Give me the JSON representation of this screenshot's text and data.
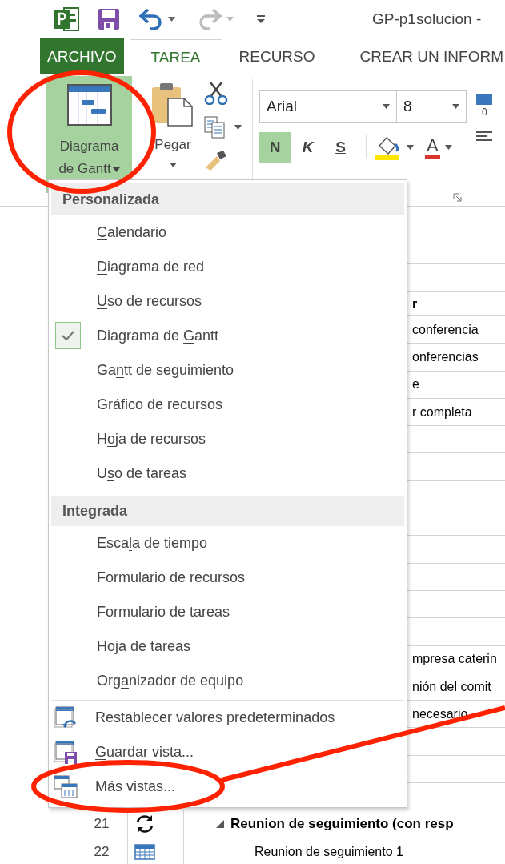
{
  "title_bar": {
    "title": "GP-p1solucion -"
  },
  "tabs": [
    {
      "label": "ARCHIVO",
      "kind": "file",
      "selected": false
    },
    {
      "label": "TAREA",
      "kind": "tab",
      "selected": true
    },
    {
      "label": "RECURSO",
      "kind": "tab",
      "selected": false
    },
    {
      "label": "CREAR UN INFORM",
      "kind": "tab",
      "selected": false
    }
  ],
  "ribbon": {
    "gantt_button": {
      "label": "Diagrama de Gantt",
      "pressed": true
    },
    "paste_button": {
      "label": "Pegar"
    },
    "font_field": {
      "value": "Arial"
    },
    "size_field": {
      "value": "8"
    },
    "format_buttons": [
      {
        "label": "N",
        "kind": "bold",
        "on": true
      },
      {
        "label": "K",
        "kind": "italic",
        "on": false
      },
      {
        "label": "S",
        "kind": "underline",
        "on": false
      }
    ],
    "font_color_button": {
      "label": "A"
    },
    "cut_label": "0"
  },
  "sheet": {
    "header_fragment": "r",
    "rows": [
      {
        "name": "conferencia"
      },
      {
        "name": "onferencias"
      },
      {
        "name": "e"
      },
      {
        "name": "r completa"
      },
      {},
      {},
      {},
      {},
      {},
      {},
      {},
      {},
      {
        "name": "mpresa caterin"
      },
      {
        "name": "nión del comit"
      },
      {
        "name": "necesario"
      },
      {},
      {},
      {},
      {
        "id": "21",
        "kind": "recurring",
        "name": "Reunion de seguimiento (con resp",
        "summary": true,
        "expanded": true,
        "children": [
          {
            "id": "22",
            "kind": "calendar",
            "name": "Reunion de seguimiento 1",
            "summary": false
          }
        ]
      }
    ]
  },
  "menu": {
    "sections": [
      {
        "title": "Personalizada",
        "items": [
          {
            "label_parts": [
              {
                "text": "C",
                "access_key": true
              },
              {
                "text": "alendario",
                "access_key": false
              }
            ],
            "checked": false
          },
          {
            "label_parts": [
              {
                "text": "D",
                "access_key": true
              },
              {
                "text": "iagrama de red",
                "access_key": false
              }
            ],
            "checked": false
          },
          {
            "label_parts": [
              {
                "text": "U",
                "access_key": true
              },
              {
                "text": "so de recursos",
                "access_key": false
              }
            ],
            "checked": false
          },
          {
            "label_parts": [
              {
                "text": "Diagrama de ",
                "access_key": false
              },
              {
                "text": "G",
                "access_key": true
              },
              {
                "text": "antt",
                "access_key": false
              }
            ],
            "checked": true
          },
          {
            "label_parts": [
              {
                "text": "Ga",
                "access_key": false
              },
              {
                "text": "n",
                "access_key": true
              },
              {
                "text": "tt de seguimiento",
                "access_key": false
              }
            ],
            "checked": false
          },
          {
            "label_parts": [
              {
                "text": "Gráfico de ",
                "access_key": false
              },
              {
                "text": "r",
                "access_key": true
              },
              {
                "text": "ecursos",
                "access_key": false
              }
            ],
            "checked": false
          },
          {
            "label_parts": [
              {
                "text": "H",
                "access_key": false
              },
              {
                "text": "o",
                "access_key": true
              },
              {
                "text": "ja de recursos",
                "access_key": false
              }
            ],
            "checked": false
          },
          {
            "label_parts": [
              {
                "text": "U",
                "access_key": false
              },
              {
                "text": "s",
                "access_key": true
              },
              {
                "text": "o de tareas",
                "access_key": false
              }
            ],
            "checked": false
          }
        ]
      },
      {
        "title": "Integrada",
        "items": [
          {
            "label_parts": [
              {
                "text": "Esca",
                "access_key": false
              },
              {
                "text": "l",
                "access_key": true
              },
              {
                "text": "a de tiempo",
                "access_key": false
              }
            ],
            "checked": false
          },
          {
            "label_parts": [
              {
                "text": "Formulario de recursos",
                "access_key": false
              }
            ],
            "checked": false
          },
          {
            "label_parts": [
              {
                "text": "Formulario de tareas",
                "access_key": false
              }
            ],
            "checked": false
          },
          {
            "label_parts": [
              {
                "text": "Hoja de tareas",
                "access_key": false
              }
            ],
            "checked": false
          },
          {
            "label_parts": [
              {
                "text": "Org",
                "access_key": false
              },
              {
                "text": "a",
                "access_key": true
              },
              {
                "text": "nizador de equipo",
                "access_key": false
              }
            ],
            "checked": false
          }
        ]
      }
    ],
    "commands": [
      {
        "kind": "reset",
        "label_parts": [
          {
            "text": "R",
            "access_key": false
          },
          {
            "text": "e",
            "access_key": true
          },
          {
            "text": "stablecer valores predeterminados",
            "access_key": false
          }
        ]
      },
      {
        "kind": "save",
        "label_parts": [
          {
            "text": "G",
            "access_key": true
          },
          {
            "text": "uardar vista...",
            "access_key": false
          }
        ]
      },
      {
        "kind": "more",
        "label_parts": [
          {
            "text": "M",
            "access_key": true
          },
          {
            "text": "ás vistas...",
            "access_key": false
          }
        ]
      }
    ]
  }
}
